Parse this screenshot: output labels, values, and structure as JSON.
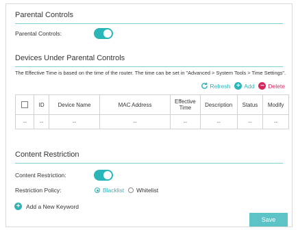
{
  "parental": {
    "section_title": "Parental Controls",
    "toggle_label": "Parental Controls:",
    "toggle_on": true
  },
  "devices": {
    "section_title": "Devices Under Parental Controls",
    "note": "The Effective Time is based on the time of the router. The time can be set in \"Advanced > System Tools > Time Settings\".",
    "actions": {
      "refresh": "Refresh",
      "add": "Add",
      "delete": "Delete"
    },
    "columns": [
      "ID",
      "Device Name",
      "MAC Address",
      "Effective Time",
      "Description",
      "Status",
      "Modify"
    ],
    "rows": [
      [
        "--",
        "--",
        "--",
        "--",
        "--",
        "--",
        "--",
        "--"
      ]
    ]
  },
  "content": {
    "section_title": "Content Restriction",
    "toggle_label": "Content Restriction:",
    "toggle_on": true,
    "policy_label": "Restriction Policy:",
    "policy_options": [
      "Blacklist",
      "Whitelist"
    ],
    "policy_selected": "Blacklist",
    "add_keyword": "Add a New Keyword"
  },
  "save_label": "Save",
  "colors": {
    "accent": "#2ab5b9",
    "danger": "#d6285e",
    "save_bg": "#5cc4c7",
    "rule": "#7fcfd3"
  }
}
